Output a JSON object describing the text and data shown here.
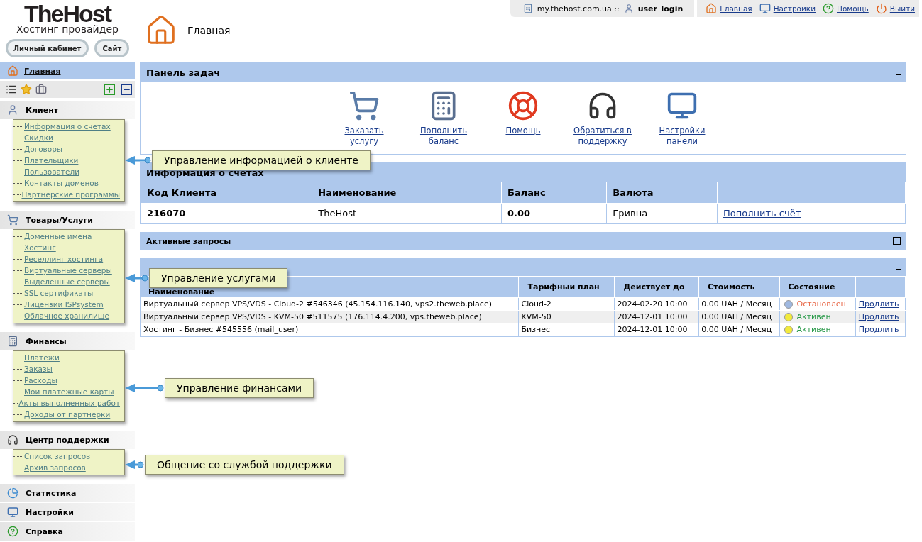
{
  "logo": {
    "name": "TheHost",
    "tagline": "Хостинг провайдер"
  },
  "header_buttons": [
    "Личный кабинет",
    "Сайт"
  ],
  "topbar": {
    "host": "my.thehost.com.ua ::",
    "user": "user_login",
    "links": [
      {
        "label": "Главная"
      },
      {
        "label": "Настройки"
      },
      {
        "label": "Помощь"
      },
      {
        "label": "Выйти"
      }
    ]
  },
  "page_title": "Главная",
  "sidebar": {
    "home": "Главная",
    "sections": [
      {
        "title": "Клиент",
        "callout": "Управление информацией о клиенте",
        "items": [
          "Информация о счетах",
          "Скидки",
          "Договоры",
          "Плательщики",
          "Пользователи",
          "Контакты доменов",
          "Партнерские программы"
        ]
      },
      {
        "title": "Товары/Услуги",
        "callout": "Управление услугами",
        "items": [
          "Доменные имена",
          "Хостинг",
          "Реселлинг хостинга",
          "Виртуальные серверы",
          "Выделенные серверы",
          "SSL сертификаты",
          "Лицензии ISPsystem",
          "Облачное хранилище"
        ]
      },
      {
        "title": "Финансы",
        "callout": "Управление финансами",
        "items": [
          "Платежи",
          "Заказы",
          "Расходы",
          "Мои платежные карты",
          "Акты выполненных работ",
          "Доходы от партнерки"
        ]
      },
      {
        "title": "Центр поддержки",
        "callout": "Общение со службой поддержки",
        "items": [
          "Список запросов",
          "Архив запросов"
        ]
      },
      {
        "title": "Статистика"
      },
      {
        "title": "Настройки"
      },
      {
        "title": "Справка"
      }
    ]
  },
  "dashboard": {
    "title": "Панель задач",
    "expanded": true,
    "actions": [
      {
        "label": "Заказать услугу"
      },
      {
        "label": "Пополнить баланс"
      },
      {
        "label": "Помощь"
      },
      {
        "label": "Обратиться в поддержку"
      },
      {
        "label": "Настройки панели"
      }
    ]
  },
  "accounts": {
    "title": "Информация о счетах",
    "columns": [
      "Код Клиента",
      "Наименование",
      "Баланс",
      "Валюта"
    ],
    "rows": [
      {
        "id": "216070",
        "name": "TheHost",
        "balance": "0.00",
        "currency": "Гривна",
        "action": "Пополнить счёт"
      }
    ]
  },
  "requests": {
    "title": "Активные запросы",
    "expanded": false
  },
  "services": {
    "expanded": true,
    "columns": [
      "Наименование",
      "Тарифный план",
      "Действует до",
      "Стоимость",
      "Состояние"
    ],
    "rows": [
      {
        "name": "Виртуальный сервер VPS/VDS - Cloud-2 #546346 (45.154.116.140, vps2.theweb.place)",
        "plan": "Cloud-2",
        "until": "2024-02-20 10:00",
        "cost": "0.00 UAH / Месяц",
        "status": "Остановлен",
        "kind": "stopped",
        "action": "Продлить"
      },
      {
        "name": "Виртуальный сервер VPS/VDS - KVM-50 #511575 (176.114.4.200, vps.theweb.place)",
        "plan": "KVM-50",
        "until": "2024-12-01 10:00",
        "cost": "0.00 UAH / Месяц",
        "status": "Активен",
        "kind": "active",
        "action": "Продлить"
      },
      {
        "name": "Хостинг - Бизнес #545556 (mail_user)",
        "plan": "Бизнес",
        "until": "2024-12-01 10:00",
        "cost": "0.00 UAH / Месяц",
        "status": "Активен",
        "kind": "active",
        "action": "Продлить"
      }
    ]
  }
}
